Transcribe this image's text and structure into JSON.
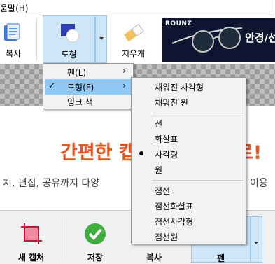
{
  "window": {
    "menu_fragment": "움말(H)"
  },
  "ribbon": {
    "copy_label": "복사",
    "shape_label": "도형",
    "eraser_label": "지우개"
  },
  "ad": {
    "brand": "ROUNZ",
    "text": "안경/선"
  },
  "page": {
    "headline": "간편한 캡",
    "headline_tail": "로!",
    "subline": "쳐, 편집, 공유까지 다양",
    "subline_tail": "이용"
  },
  "bottom_toolbar": {
    "new_capture_label": "새 캡처",
    "save_label": "저장",
    "copy_label": "복사",
    "pen_label": "펜"
  },
  "context_menu": {
    "items": [
      {
        "label": "펜(L)",
        "has_submenu": true,
        "checked": false
      },
      {
        "label": "도형(F)",
        "has_submenu": true,
        "checked": true
      },
      {
        "label": "잉크 색",
        "has_submenu": false,
        "checked": false
      }
    ]
  },
  "shape_submenu": {
    "groups": [
      [
        "채워진 사각형",
        "채워진 원"
      ],
      [
        "선",
        "화살표",
        "사각형",
        "원"
      ],
      [
        "점선",
        "점선화살표",
        "점선사각형",
        "점선원"
      ]
    ],
    "selected": "사각형"
  },
  "colors": {
    "highlight": "#90c8f6",
    "accent_orange": "#e8541d",
    "active_tool": "#cfe6f9"
  }
}
